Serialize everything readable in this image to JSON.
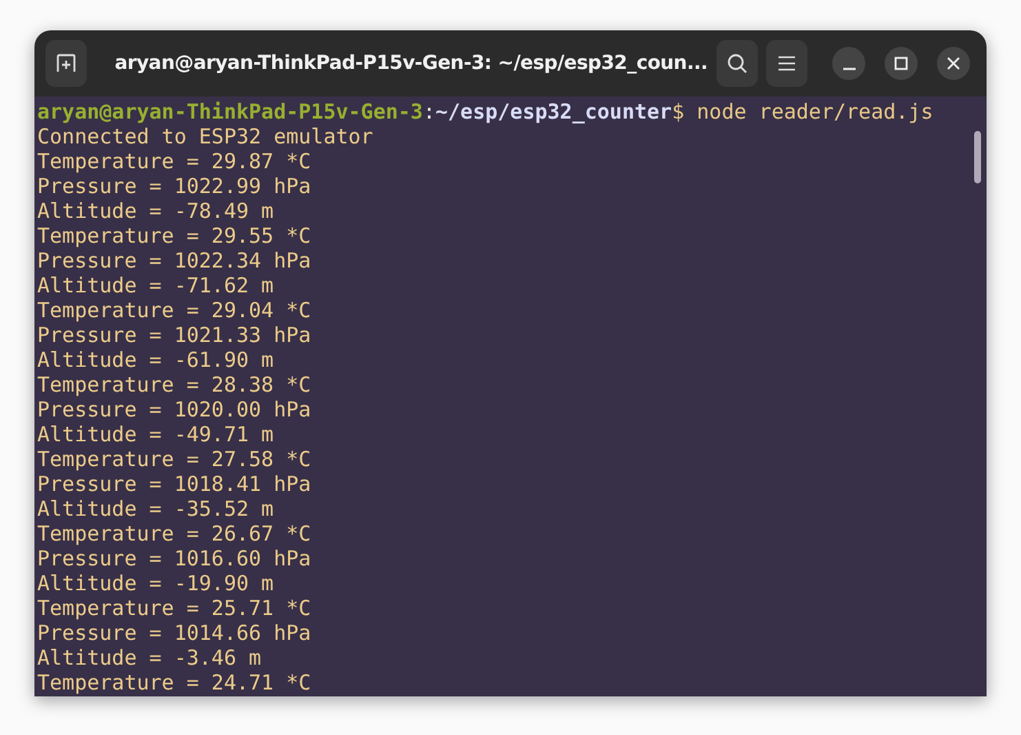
{
  "window": {
    "title": "aryan@aryan-ThinkPad-P15v-Gen-3: ~/esp/esp32_coun..."
  },
  "terminal": {
    "lines": [
      {
        "kind": "prompt",
        "user_host": "aryan@aryan-ThinkPad-P15v-Gen-3",
        "separator": ":",
        "path": "~/esp/esp32_counter",
        "symbol": "$",
        "command": "node reader/read.js"
      },
      {
        "kind": "output",
        "text": "Connected to ESP32 emulator"
      },
      {
        "kind": "output",
        "text": "Temperature = 29.87 *C"
      },
      {
        "kind": "output",
        "text": "Pressure = 1022.99 hPa"
      },
      {
        "kind": "output",
        "text": "Altitude = -78.49 m"
      },
      {
        "kind": "output",
        "text": "Temperature = 29.55 *C"
      },
      {
        "kind": "output",
        "text": "Pressure = 1022.34 hPa"
      },
      {
        "kind": "output",
        "text": "Altitude = -71.62 m"
      },
      {
        "kind": "output",
        "text": "Temperature = 29.04 *C"
      },
      {
        "kind": "output",
        "text": "Pressure = 1021.33 hPa"
      },
      {
        "kind": "output",
        "text": "Altitude = -61.90 m"
      },
      {
        "kind": "output",
        "text": "Temperature = 28.38 *C"
      },
      {
        "kind": "output",
        "text": "Pressure = 1020.00 hPa"
      },
      {
        "kind": "output",
        "text": "Altitude = -49.71 m"
      },
      {
        "kind": "output",
        "text": "Temperature = 27.58 *C"
      },
      {
        "kind": "output",
        "text": "Pressure = 1018.41 hPa"
      },
      {
        "kind": "output",
        "text": "Altitude = -35.52 m"
      },
      {
        "kind": "output",
        "text": "Temperature = 26.67 *C"
      },
      {
        "kind": "output",
        "text": "Pressure = 1016.60 hPa"
      },
      {
        "kind": "output",
        "text": "Altitude = -19.90 m"
      },
      {
        "kind": "output",
        "text": "Temperature = 25.71 *C"
      },
      {
        "kind": "output",
        "text": "Pressure = 1014.66 hPa"
      },
      {
        "kind": "output",
        "text": "Altitude = -3.46 m"
      },
      {
        "kind": "output",
        "text": "Temperature = 24.71 *C"
      }
    ]
  }
}
